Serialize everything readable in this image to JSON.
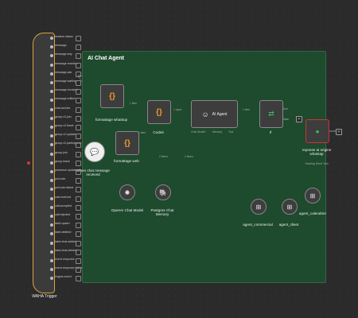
{
  "sticky_note": {
    "title": "AI Chat Agent"
  },
  "trigger": {
    "label": "WAHA Trigger",
    "events": [
      "session.status",
      "message",
      "message.any",
      "message.reaction",
      "message.ack",
      "message.waiting",
      "message.revoked",
      "message.edited",
      "chat.archive",
      "group.v2.join",
      "group.v2.leave",
      "group.v2.update",
      "group.v2.participants",
      "group.join",
      "group.leave",
      "presence.update",
      "poll.vote",
      "poll.vote.failed",
      "call.received",
      "call.accepted",
      "call.rejected",
      "label.upsert",
      "label.deleted",
      "label.chat.added",
      "label.chat.deleted",
      "event.response",
      "event.response.failed",
      "engine.event"
    ]
  },
  "nodes": {
    "formattage_whatsup": "formattage whatsup",
    "formattage_web": "formattage web",
    "code5": "Code5",
    "ai_agent": "AI Agent",
    "if": "If",
    "chat_trigger": "When chat message received",
    "reponse": "reponse ai origine whatsap",
    "reponse_sub": "Starting Send Text",
    "openai": "OpenAI Chat Model",
    "postgres": "Postgres Chat Memory",
    "agent_commercial": "agent_commercial",
    "agent_client": "agent_client",
    "agent_calendrier": "agent_calendrier"
  },
  "edges": {
    "items1": "1 item",
    "items2": "1 item",
    "input": "1 input",
    "items3": "1 item",
    "items4": "2 items",
    "items5": "2 items",
    "true": "true",
    "false": "false"
  },
  "ports": {
    "chat_model": "Chat Model*",
    "memory": "Memory",
    "tool": "Tool"
  },
  "colors": {
    "sticky": "#1e4a2e",
    "accent": "#f29b2c",
    "trigger_border": "#d9a33b"
  }
}
